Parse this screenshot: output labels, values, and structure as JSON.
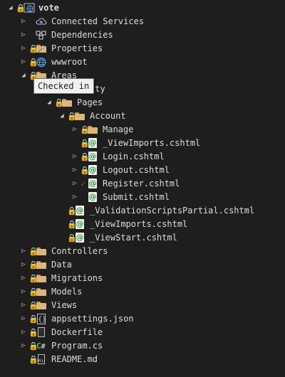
{
  "explorer": {
    "root": {
      "label": "vote"
    },
    "items": {
      "connected_services": "Connected Services",
      "dependencies": "Dependencies",
      "properties": "Properties",
      "wwwroot": "wwwroot",
      "areas": "Areas",
      "identity": "ity",
      "pages": "Pages",
      "account": "Account",
      "manage": "Manage",
      "viewimports_account": "_ViewImports.cshtml",
      "login": "Login.cshtml",
      "logout": "Logout.cshtml",
      "register": "Register.cshtml",
      "submit": "Submit.cshtml",
      "validation_partial": "_ValidationScriptsPartial.cshtml",
      "viewimports_pages": "_ViewImports.cshtml",
      "viewstart": "_ViewStart.cshtml",
      "controllers": "Controllers",
      "data": "Data",
      "migrations": "Migrations",
      "models": "Models",
      "views": "Views",
      "appsettings": "appsettings.json",
      "dockerfile": "Dockerfile",
      "program": "Program.cs",
      "readme": "README.md"
    },
    "glyphs": {
      "collapsed": "▷",
      "expanded": "◢",
      "lock": "🔒",
      "check": "✓",
      "razor": "@",
      "json": "{}",
      "csharp": "C",
      "csharp_hash": "#",
      "md": "M↓"
    }
  },
  "tooltip": {
    "text": "Checked in"
  },
  "colors": {
    "background": "#1e1e1e",
    "text": "#dcdcdc",
    "lock": "#4c9be8",
    "folder": "#dcb67a",
    "razor": "#2a9b3a",
    "pending_check": "#d13438"
  }
}
